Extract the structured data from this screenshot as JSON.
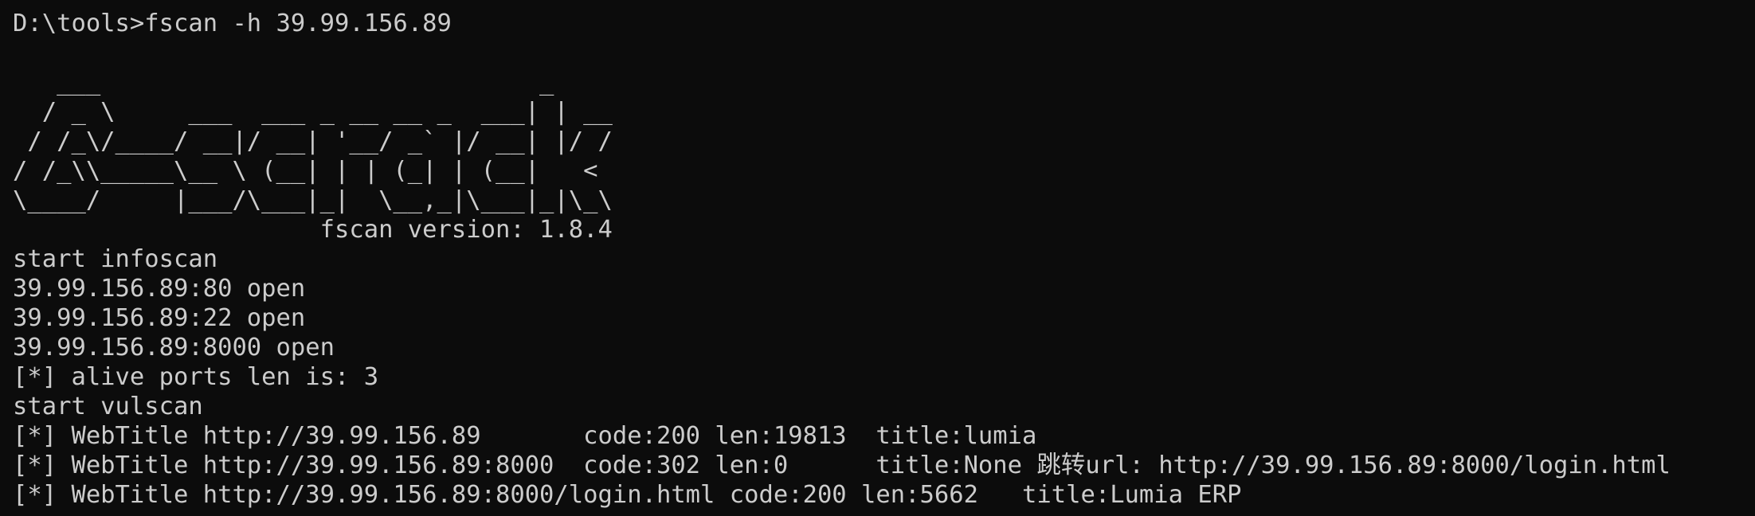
{
  "terminal": {
    "background": "#0c0c0c",
    "foreground": "#cccccc",
    "prompt_line": "D:\\tools>fscan -h 39.99.156.89",
    "blank_line": "",
    "banner": [
      "   ___                              _",
      "  / _ \\     ___  ___ _ __ __ _  ___| | __",
      " / /_\\/____/ __|/ __| '__/ _` |/ __| |/ /",
      "/ /_\\\\_____\\__ \\ (__| | | (_| | (__|   <",
      "\\____/     |___/\\___|_|  \\__,_|\\___|_|\\_\\"
    ],
    "version_line": "                     fscan version: 1.8.4",
    "output": [
      "start infoscan",
      "39.99.156.89:80 open",
      "39.99.156.89:22 open",
      "39.99.156.89:8000 open",
      "[*] alive ports len is: 3",
      "start vulscan",
      "[*] WebTitle http://39.99.156.89       code:200 len:19813  title:lumia",
      "[*] WebTitle http://39.99.156.89:8000  code:302 len:0      title:None 跳转url: http://39.99.156.89:8000/login.html",
      "[*] WebTitle http://39.99.156.89:8000/login.html code:200 len:5662   title:Lumia ERP"
    ]
  }
}
